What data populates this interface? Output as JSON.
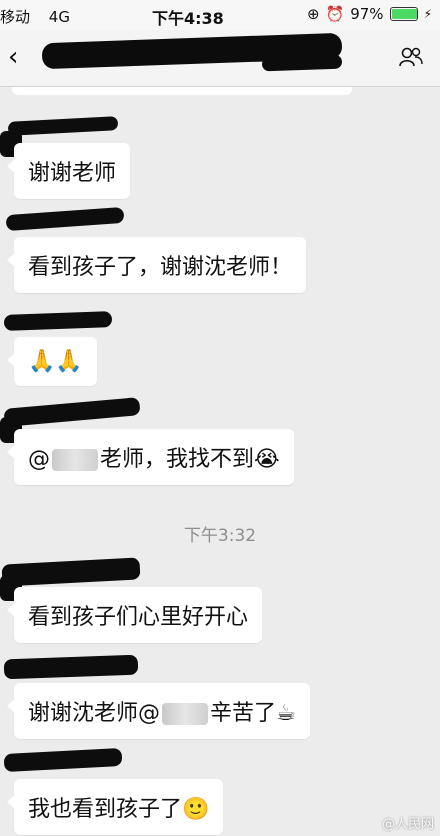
{
  "status_bar": {
    "carrier": "移动",
    "network": "4G",
    "time": "下午4:38",
    "battery_percent": "97%",
    "battery_level": 0.97
  },
  "chat": {
    "time_divider": "下午3:32",
    "messages": [
      {
        "text": "谢谢老师"
      },
      {
        "text": "看到孩子了，谢谢沈老师！"
      },
      {
        "text": "🙏🙏"
      },
      {
        "prefix": "@",
        "text": "老师，我找不到",
        "emoji": "😭"
      },
      {
        "text": "看到孩子们心里好开心"
      },
      {
        "text": "谢谢沈老师@",
        "suffix": "辛苦了",
        "emoji": "☕"
      },
      {
        "text": "我也看到孩子了",
        "emoji": "🙂"
      }
    ]
  },
  "watermark": "@人民网",
  "colors": {
    "background": "#ececec",
    "bubble": "#ffffff",
    "battery": "#4cd964"
  }
}
